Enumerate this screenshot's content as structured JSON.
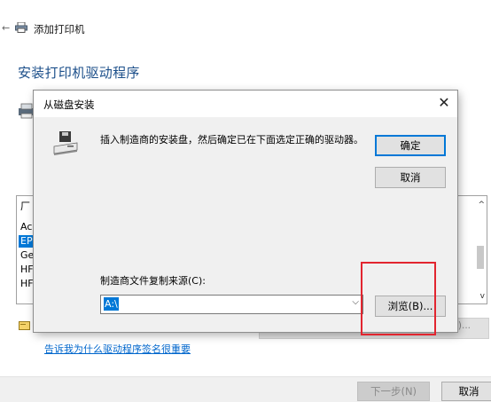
{
  "wizard": {
    "back_glyph": "←",
    "title": "添加打印机",
    "heading": "安装打印机驱动程序",
    "list_header": "厂",
    "list_items": [
      "Ac",
      "EP",
      "Ge",
      "HF",
      "HF"
    ],
    "selected_index": 1,
    "scroll_up": "^",
    "scroll_down": "v",
    "windows_update_partial": "H)...",
    "sign_link": "告诉我为什么驱动程序签名很重要",
    "next_button": "下一步(N)",
    "cancel_button": "取消"
  },
  "dialog": {
    "title": "从磁盘安装",
    "close_glyph": "✕",
    "message": "插入制造商的安装盘，然后确定已在下面选定正确的驱动器。",
    "ok_button": "确定",
    "cancel_button": "取消",
    "copy_label": "制造商文件复制来源(C):",
    "path_value": "A:\\",
    "combo_arrow": "⌵",
    "browse_button": "浏览(B)..."
  },
  "highlight_color": "#e2252f",
  "accent_color": "#0078d7"
}
